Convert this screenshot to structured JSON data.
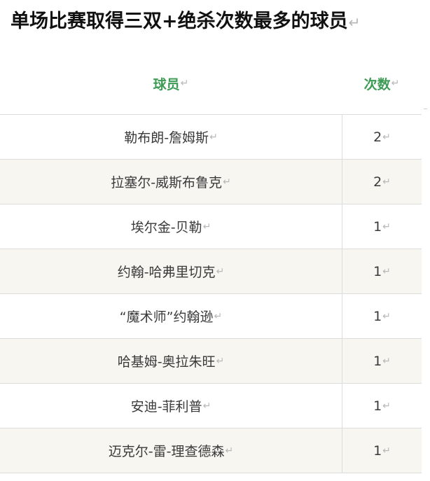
{
  "title": "单场比赛取得三双+绝杀次数最多的球员",
  "paragraph_mark": "↵",
  "columns": {
    "player": "球员",
    "count": "次数"
  },
  "rows": [
    {
      "player": "勒布朗-詹姆斯",
      "count": "2"
    },
    {
      "player": "拉塞尔-威斯布鲁克",
      "count": "2"
    },
    {
      "player": "埃尔金-贝勒",
      "count": "1"
    },
    {
      "player": "约翰-哈弗里切克",
      "count": "1"
    },
    {
      "player": "“魔术师”约翰逊",
      "count": "1"
    },
    {
      "player": "哈基姆-奥拉朱旺",
      "count": "1"
    },
    {
      "player": "安迪-菲利普",
      "count": "1"
    },
    {
      "player": "迈克尔-雷-理查德森",
      "count": "1"
    }
  ],
  "colors": {
    "header_text": "#3e9b56",
    "alt_row_bg": "#f7f6f1",
    "border": "#dcdcdc"
  }
}
